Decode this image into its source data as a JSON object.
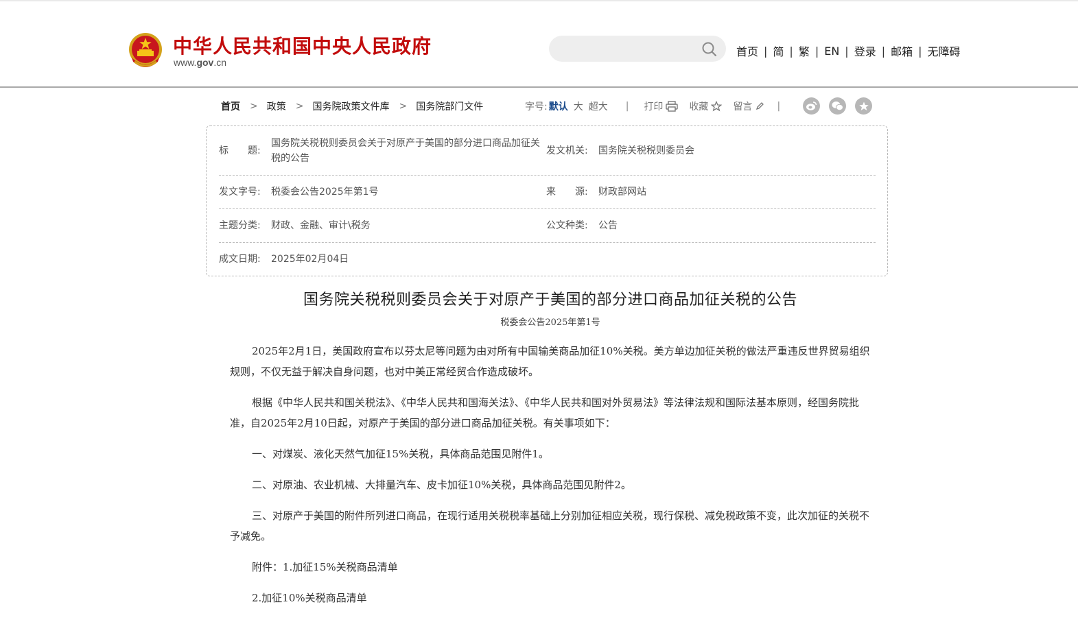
{
  "header": {
    "site_title": "中华人民共和国中央人民政府",
    "site_url_prefix": "www.",
    "site_url_domain": "gov",
    "site_url_suffix": ".cn",
    "search_placeholder": "",
    "nav": [
      "首页",
      "简",
      "繁",
      "EN",
      "登录",
      "邮箱",
      "无障碍"
    ],
    "nav_separator": "|"
  },
  "breadcrumb": {
    "items": [
      "首页",
      "政策",
      "国务院政策文件库",
      "国务院部门文件"
    ],
    "arrow": ">"
  },
  "tools": {
    "font_size_label": "字号:",
    "font_sizes": [
      "默认",
      "大",
      "超大"
    ],
    "separator": "|",
    "print": "打印",
    "favorite": "收藏",
    "comment": "留言"
  },
  "share_icons": [
    "weibo-icon",
    "wechat-icon",
    "favorite-star-icon"
  ],
  "info": {
    "title_label": "标　　题:",
    "title_value": "国务院关税税则委员会关于对原产于美国的部分进口商品加征关税的公告",
    "issuer_label": "发文机关:",
    "issuer_value": "国务院关税税则委员会",
    "doc_no_label": "发文字号:",
    "doc_no_value": "税委会公告2025年第1号",
    "source_label": "来　　源:",
    "source_value": "财政部网站",
    "topic_label": "主题分类:",
    "topic_value": "财政、金融、审计\\税务",
    "type_label": "公文种类:",
    "type_value": "公告",
    "date_label": "成文日期:",
    "date_value": "2025年02月04日"
  },
  "article": {
    "title": "国务院关税税则委员会关于对原产于美国的部分进口商品加征关税的公告",
    "doc_no": "税委会公告2025年第1号",
    "paragraphs": [
      "2025年2月1日，美国政府宣布以芬太尼等问题为由对所有中国输美商品加征10%关税。美方单边加征关税的做法严重违反世界贸易组织规则，不仅无益于解决自身问题，也对中美正常经贸合作造成破坏。",
      "根据《中华人民共和国关税法》、《中华人民共和国海关法》、《中华人民共和国对外贸易法》等法律法规和国际法基本原则，经国务院批准，自2025年2月10日起，对原产于美国的部分进口商品加征关税。有关事项如下：",
      "一、对煤炭、液化天然气加征15%关税，具体商品范围见附件1。",
      "二、对原油、农业机械、大排量汽车、皮卡加征10%关税，具体商品范围见附件2。",
      "三、对原产于美国的附件所列进口商品，在现行适用关税税率基础上分别加征相应关税，现行保税、减免税政策不变，此次加征的关税不予减免。",
      "附件：1.加征15%关税商品清单",
      "2.加征10%关税商品清单"
    ]
  },
  "colors": {
    "brand_red": "#c20c0c",
    "link_blue": "#1a4a8a",
    "share_gray": "#b7b7b7"
  }
}
